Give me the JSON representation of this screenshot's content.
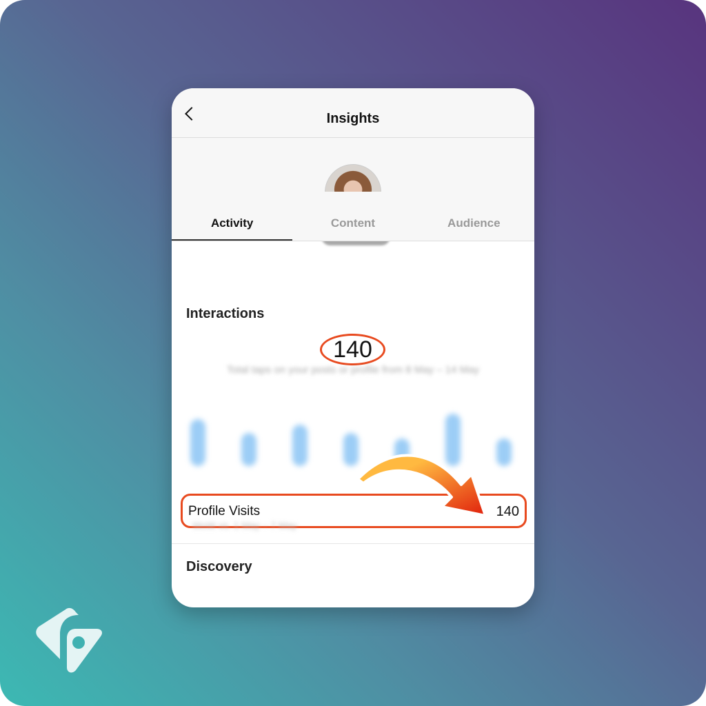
{
  "header": {
    "title": "Insights",
    "back_icon": "chevron-left-icon"
  },
  "tabs": [
    {
      "label": "Activity",
      "active": true
    },
    {
      "label": "Content",
      "active": false
    },
    {
      "label": "Audience",
      "active": false
    }
  ],
  "interactions": {
    "title": "Interactions",
    "value": "140",
    "description": "Total taps on your posts or profile from 8 May – 14 May",
    "bar_relative_levels": [
      0.85,
      0.6,
      0.75,
      0.6,
      0.5,
      0.95,
      0.5
    ]
  },
  "profile_visits": {
    "label": "Profile Visits",
    "value": "140",
    "subtitle": "WoW vs. 1 May – 7 May"
  },
  "discovery": {
    "title": "Discovery"
  },
  "colors": {
    "highlight": "#e84a1f",
    "arrow_start": "#ffb940",
    "arrow_end": "#e0200c",
    "bar": "#9ccdf6"
  }
}
